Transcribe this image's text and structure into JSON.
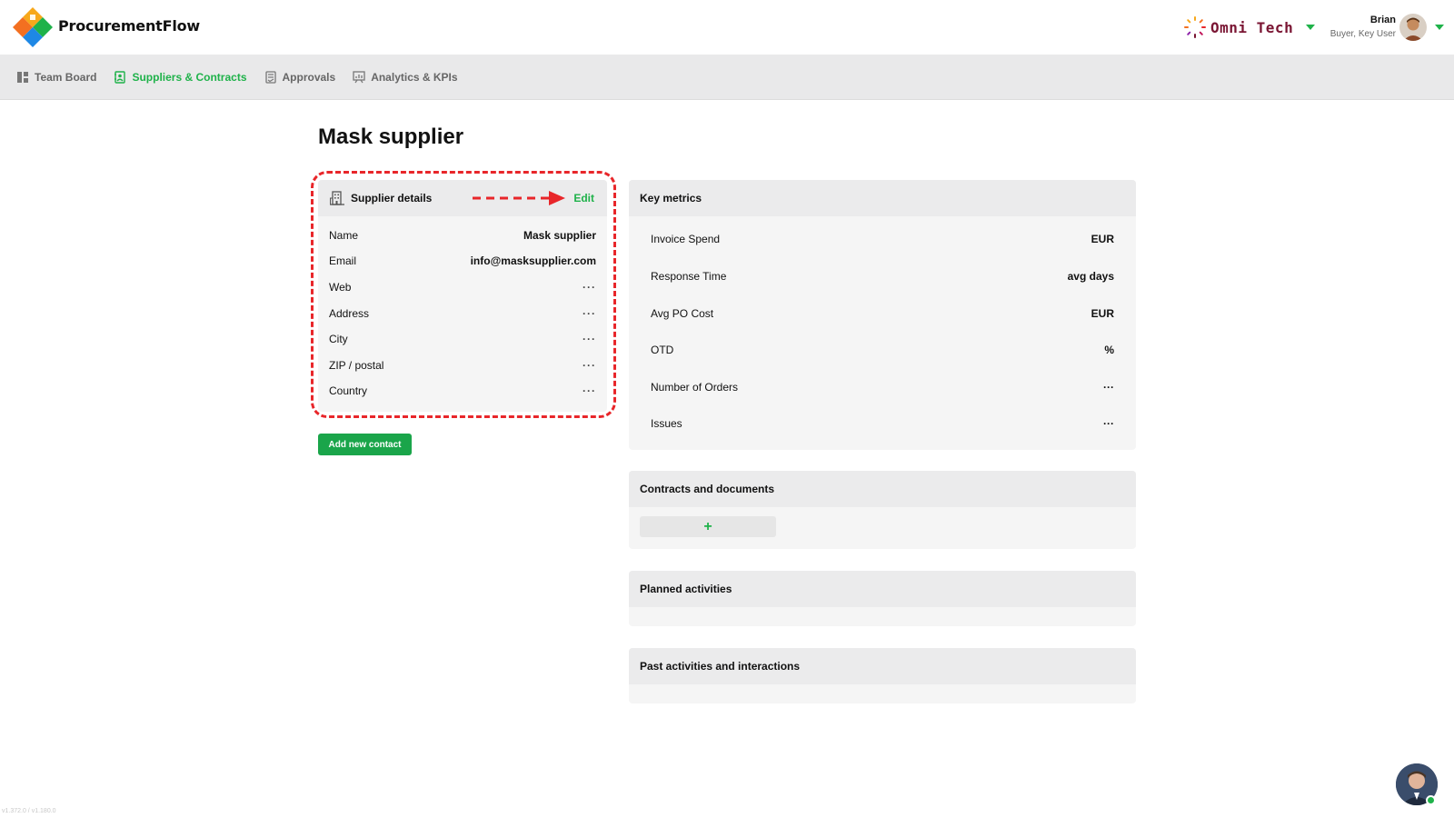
{
  "header": {
    "brand": "ProcurementFlow",
    "company": "Omni Tech",
    "user_name": "Brian",
    "user_role": "Buyer, Key User"
  },
  "nav": {
    "items": [
      {
        "label": "Team Board",
        "active": false
      },
      {
        "label": "Suppliers & Contracts",
        "active": true
      },
      {
        "label": "Approvals",
        "active": false
      },
      {
        "label": "Analytics & KPIs",
        "active": false
      }
    ]
  },
  "page": {
    "title": "Mask supplier"
  },
  "supplier_details": {
    "title": "Supplier details",
    "edit_label": "Edit",
    "rows": [
      {
        "label": "Name",
        "value": "Mask supplier"
      },
      {
        "label": "Email",
        "value": "info@masksupplier.com"
      },
      {
        "label": "Web",
        "value": "···"
      },
      {
        "label": "Address",
        "value": "···"
      },
      {
        "label": "City",
        "value": "···"
      },
      {
        "label": "ZIP / postal",
        "value": "···"
      },
      {
        "label": "Country",
        "value": "···"
      }
    ],
    "add_contact_label": "Add new contact"
  },
  "key_metrics": {
    "title": "Key metrics",
    "rows": [
      {
        "label": "Invoice Spend",
        "value": "EUR"
      },
      {
        "label": "Response Time",
        "value": "avg days"
      },
      {
        "label": "Avg PO Cost",
        "value": "EUR"
      },
      {
        "label": "OTD",
        "value": "%"
      },
      {
        "label": "Number of Orders",
        "value": "···"
      },
      {
        "label": "Issues",
        "value": "···"
      }
    ]
  },
  "contracts": {
    "title": "Contracts and documents",
    "add_label": "+"
  },
  "planned": {
    "title": "Planned activities"
  },
  "past": {
    "title": "Past activities and interactions"
  },
  "footer": {
    "version": "v1.372.0 / v1.180.0"
  },
  "colors": {
    "accent": "#1fb24a",
    "annotation": "#e8262a",
    "company_text": "#7a1533"
  }
}
